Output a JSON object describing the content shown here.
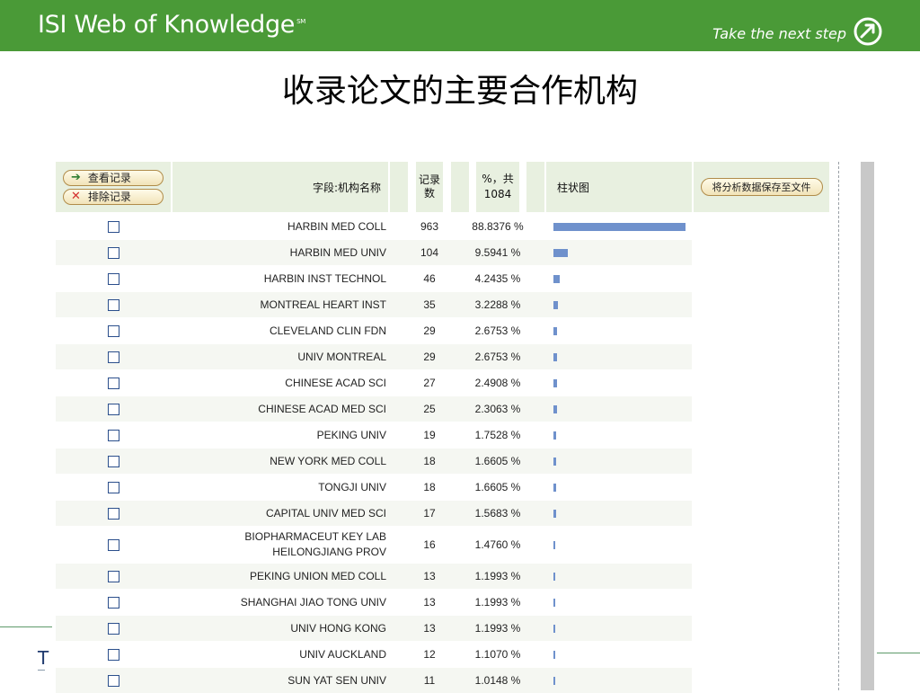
{
  "header": {
    "brand": "ISI Web of Knowledge",
    "brand_mark": "SM",
    "tagline": "Take the next step"
  },
  "title": "收录论文的主要合作机构",
  "table": {
    "view_button": "查看记录",
    "exclude_button": "排除记录",
    "field_header": "字段:机构名称",
    "count_header": "记录数",
    "percent_header": "%，共 1084",
    "chart_header": "柱状图",
    "save_button": "将分析数据保存至文件"
  },
  "chart_data": {
    "type": "bar",
    "orientation": "horizontal",
    "total": 1084,
    "categories": [
      "HARBIN MED COLL",
      "HARBIN MED UNIV",
      "HARBIN INST TECHNOL",
      "MONTREAL HEART INST",
      "CLEVELAND CLIN FDN",
      "UNIV MONTREAL",
      "CHINESE ACAD SCI",
      "CHINESE ACAD MED SCI",
      "PEKING UNIV",
      "NEW YORK MED COLL",
      "TONGJI UNIV",
      "CAPITAL UNIV MED SCI",
      "BIOPHARMACEUT KEY LAB HEILONGJIANG PROV",
      "PEKING UNION MED COLL",
      "SHANGHAI JIAO TONG UNIV",
      "UNIV HONG KONG",
      "UNIV AUCKLAND",
      "SUN YAT SEN UNIV"
    ],
    "values": [
      963,
      104,
      46,
      35,
      29,
      29,
      27,
      25,
      19,
      18,
      18,
      17,
      16,
      13,
      13,
      13,
      12,
      11
    ],
    "percent_labels": [
      "88.8376 %",
      "9.5941 %",
      "4.2435 %",
      "3.2288 %",
      "2.6753 %",
      "2.6753 %",
      "2.4908 %",
      "2.3063 %",
      "1.7528 %",
      "1.6605 %",
      "1.6605 %",
      "1.5683 %",
      "1.4760 %",
      "1.1993 %",
      "1.1993 %",
      "1.1993 %",
      "1.1070 %",
      "1.0148 %"
    ],
    "bar_color": "#6f91cc",
    "grid": false
  }
}
